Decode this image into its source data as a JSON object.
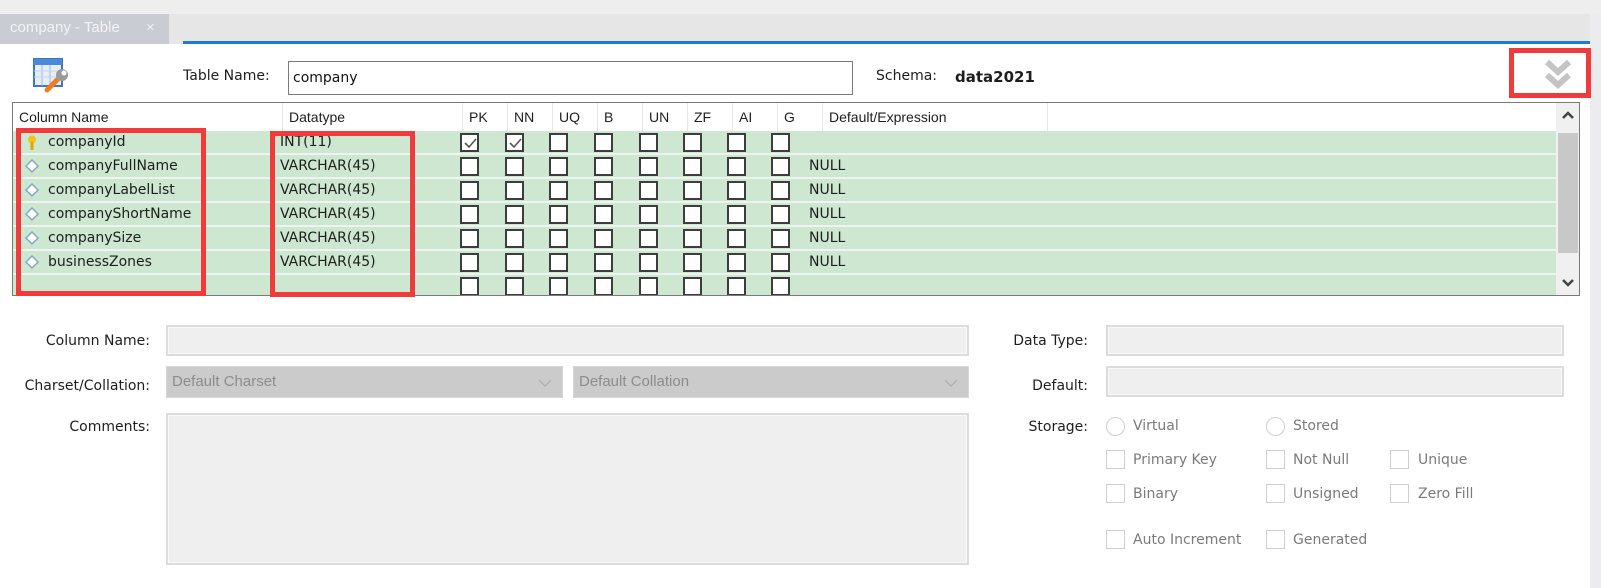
{
  "tab": {
    "title": "company - Table",
    "close_glyph": "×"
  },
  "header": {
    "table_name_label": "Table Name:",
    "table_name_value": "company",
    "schema_label": "Schema:",
    "schema_value": "data2021",
    "collapse_icon": "double-chevron-down-icon"
  },
  "grid": {
    "columns": [
      "Column Name",
      "Datatype",
      "PK",
      "NN",
      "UQ",
      "B",
      "UN",
      "ZF",
      "AI",
      "G",
      "Default/Expression"
    ],
    "rows": [
      {
        "name": "companyId",
        "icon": "primary-key-icon",
        "datatype": "INT(11)",
        "pk": true,
        "nn": true,
        "uq": false,
        "b": false,
        "un": false,
        "zf": false,
        "ai": false,
        "g": false,
        "default": ""
      },
      {
        "name": "companyFullName",
        "icon": "column-diamond-icon",
        "datatype": "VARCHAR(45)",
        "pk": false,
        "nn": false,
        "uq": false,
        "b": false,
        "un": false,
        "zf": false,
        "ai": false,
        "g": false,
        "default": "NULL"
      },
      {
        "name": "companyLabelList",
        "icon": "column-diamond-icon",
        "datatype": "VARCHAR(45)",
        "pk": false,
        "nn": false,
        "uq": false,
        "b": false,
        "un": false,
        "zf": false,
        "ai": false,
        "g": false,
        "default": "NULL"
      },
      {
        "name": "companyShortName",
        "icon": "column-diamond-icon",
        "datatype": "VARCHAR(45)",
        "pk": false,
        "nn": false,
        "uq": false,
        "b": false,
        "un": false,
        "zf": false,
        "ai": false,
        "g": false,
        "default": "NULL"
      },
      {
        "name": "companySize",
        "icon": "column-diamond-icon",
        "datatype": "VARCHAR(45)",
        "pk": false,
        "nn": false,
        "uq": false,
        "b": false,
        "un": false,
        "zf": false,
        "ai": false,
        "g": false,
        "default": "NULL"
      },
      {
        "name": "businessZones",
        "icon": "column-diamond-icon",
        "datatype": "VARCHAR(45)",
        "pk": false,
        "nn": false,
        "uq": false,
        "b": false,
        "un": false,
        "zf": false,
        "ai": false,
        "g": false,
        "default": "NULL"
      }
    ]
  },
  "details": {
    "column_name_label": "Column Name:",
    "column_name_value": "",
    "charset_label": "Charset/Collation:",
    "charset_value": "Default Charset",
    "collation_value": "Default Collation",
    "comments_label": "Comments:",
    "comments_value": "",
    "data_type_label": "Data Type:",
    "data_type_value": "",
    "default_label": "Default:",
    "default_value": "",
    "storage_label": "Storage:",
    "storage_options": [
      "Virtual",
      "Stored"
    ],
    "flags": [
      "Primary Key",
      "Not Null",
      "Unique",
      "Binary",
      "Unsigned",
      "Zero Fill",
      "Auto Increment",
      "Generated"
    ]
  },
  "colors": {
    "accent": "#1c7bd6",
    "row_bg": "#cde7d0",
    "highlight": "#f23a3a"
  }
}
